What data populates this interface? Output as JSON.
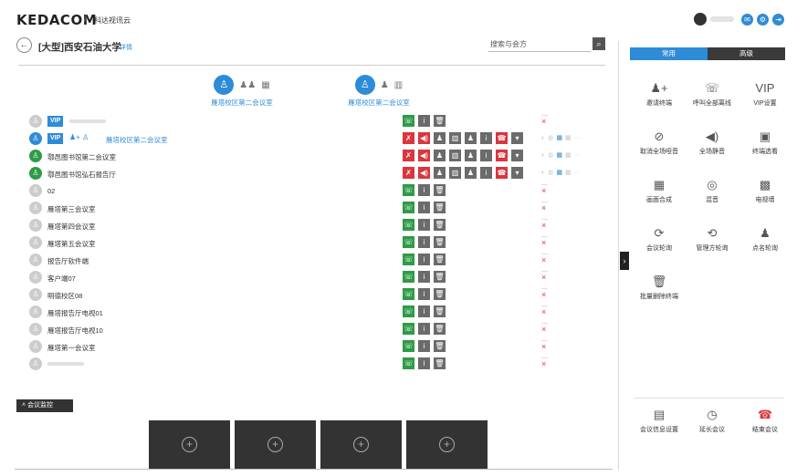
{
  "header": {
    "logo": "KEDACOM",
    "separator": "/",
    "product": "科达视讯云"
  },
  "page": {
    "back_icon": "arrow-left-icon",
    "title": "[大型]西安石油大学",
    "detail_link": "详情",
    "search_placeholder": "搜索与会方"
  },
  "channels": [
    {
      "label": "雁塔校区第二会议室"
    },
    {
      "label": "雁塔校区第二会议室"
    }
  ],
  "participants": [
    {
      "name": "",
      "vip": true,
      "status": "offline"
    },
    {
      "name": "雁塔校区第二会议室",
      "vip": true,
      "status": "speaker"
    },
    {
      "name": "鄠邑图书馆第二会议室",
      "vip": false,
      "status": "online"
    },
    {
      "name": "鄠邑图书馆弘石报告厅",
      "vip": false,
      "status": "online"
    },
    {
      "name": "02",
      "vip": false,
      "status": "offline"
    },
    {
      "name": "雁塔第三会议室",
      "vip": false,
      "status": "offline"
    },
    {
      "name": "雁塔第四会议室",
      "vip": false,
      "status": "offline"
    },
    {
      "name": "雁塔第五会议室",
      "vip": false,
      "status": "offline"
    },
    {
      "name": "报告厅软件端",
      "vip": false,
      "status": "offline"
    },
    {
      "name": "客户端07",
      "vip": false,
      "status": "offline"
    },
    {
      "name": "明德校区08",
      "vip": false,
      "status": "offline"
    },
    {
      "name": "雁塔报告厅电视01",
      "vip": false,
      "status": "offline"
    },
    {
      "name": "雁塔报告厅电视10",
      "vip": false,
      "status": "offline"
    },
    {
      "name": "雁塔第一会议室",
      "vip": false,
      "status": "offline"
    },
    {
      "name": "",
      "vip": false,
      "status": "offline"
    }
  ],
  "vip_label": "VIP",
  "right_panel": {
    "tabs": [
      {
        "label": "常用"
      },
      {
        "label": "高级"
      }
    ],
    "actions": [
      {
        "label": "邀请终端",
        "icon": "invite-icon"
      },
      {
        "label": "呼叫全部离线",
        "icon": "phone-icon"
      },
      {
        "label": "VIP设置",
        "icon": "vip-icon"
      },
      {
        "label": "取消全场哑音",
        "icon": "mic-mute-icon"
      },
      {
        "label": "全场静音",
        "icon": "speaker-icon"
      },
      {
        "label": "终端选看",
        "icon": "terminal-view-icon"
      },
      {
        "label": "画面合成",
        "icon": "layout-icon"
      },
      {
        "label": "混音",
        "icon": "mix-icon"
      },
      {
        "label": "电视墙",
        "icon": "tv-wall-icon"
      },
      {
        "label": "会议轮询",
        "icon": "poll-icon"
      },
      {
        "label": "管理方轮询",
        "icon": "manager-poll-icon"
      },
      {
        "label": "点名轮询",
        "icon": "rollcall-icon"
      },
      {
        "label": "批量删除终端",
        "icon": "trash-icon"
      }
    ],
    "bottom_actions": [
      {
        "label": "会议信息设置",
        "icon": "settings-doc-icon"
      },
      {
        "label": "延长会议",
        "icon": "clock-icon"
      },
      {
        "label": "结束会议",
        "icon": "hangup-icon",
        "color": "#d9363e"
      }
    ]
  },
  "monitor": {
    "label": "会议监控",
    "slots": 4
  },
  "colors": {
    "accent": "#2e8bd8",
    "green": "#2e9b46",
    "red": "#d9363e",
    "dark": "#333333"
  }
}
